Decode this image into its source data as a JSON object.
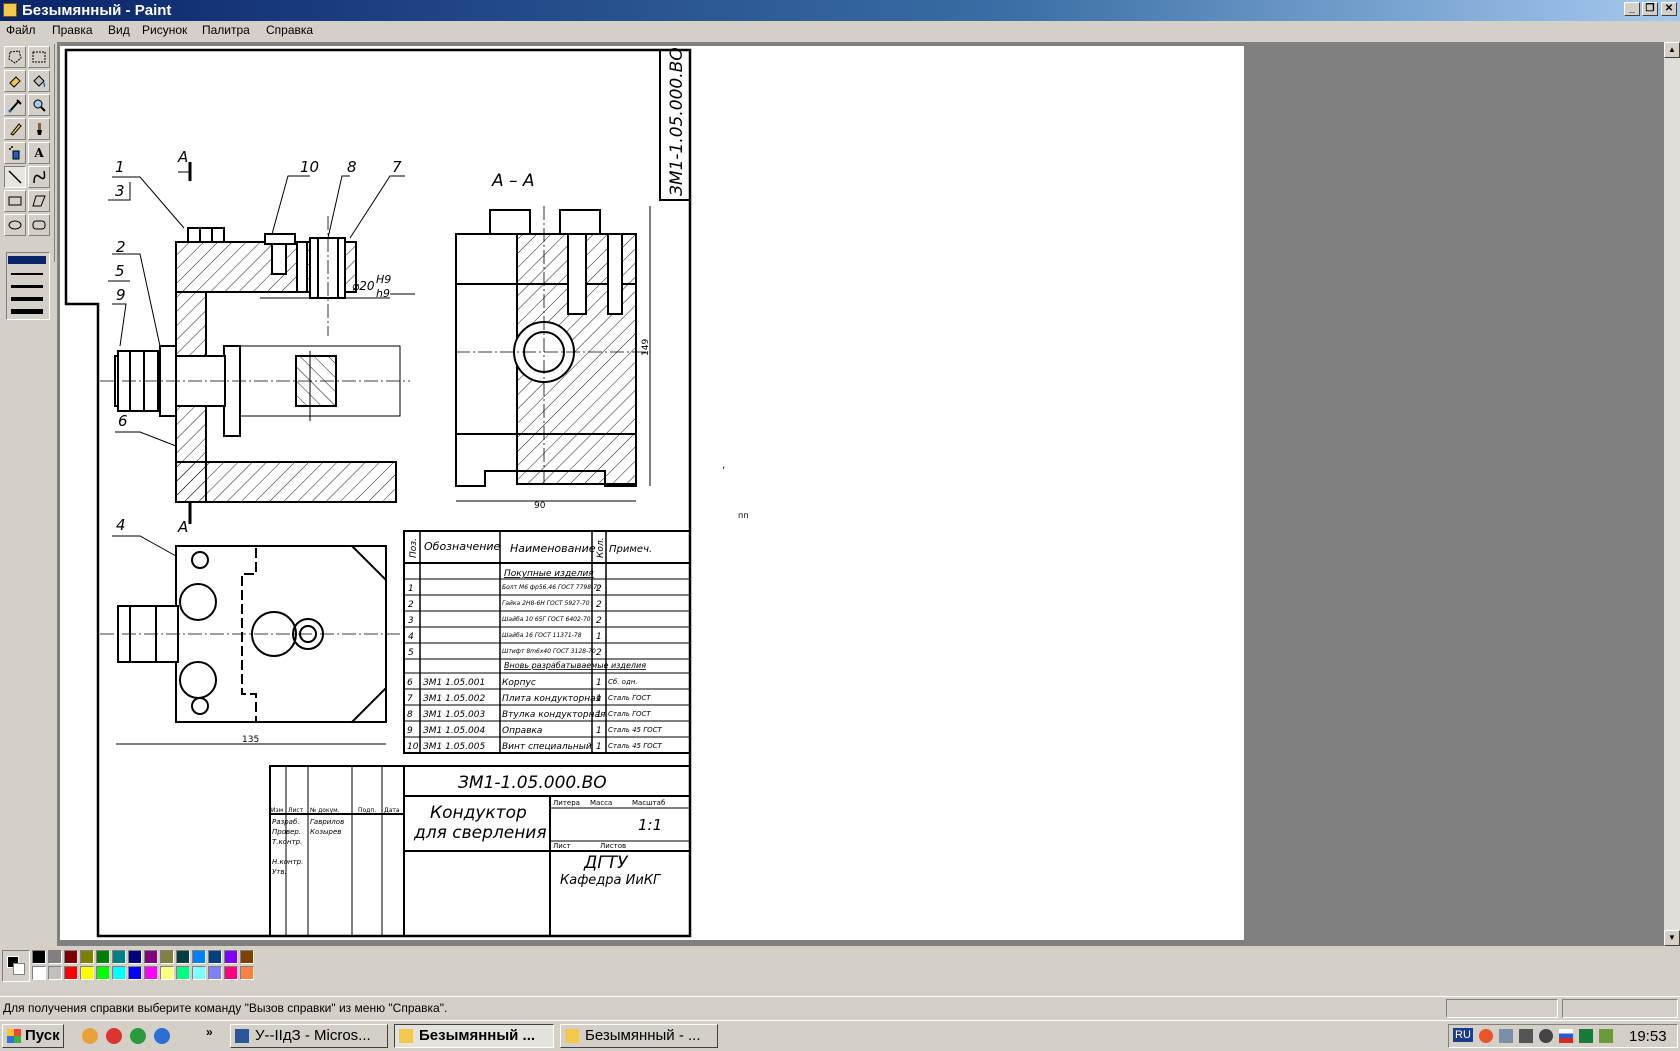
{
  "window": {
    "title": "Безымянный - Paint",
    "minimize": "_",
    "restore": "❐",
    "close": "✕"
  },
  "menu": [
    "Файл",
    "Правка",
    "Вид",
    "Рисунок",
    "Палитра",
    "Справка"
  ],
  "tools": [
    {
      "name": "free-select-icon"
    },
    {
      "name": "rect-select-icon"
    },
    {
      "name": "eraser-icon"
    },
    {
      "name": "fill-icon"
    },
    {
      "name": "pick-color-icon"
    },
    {
      "name": "magnifier-icon"
    },
    {
      "name": "pencil-icon"
    },
    {
      "name": "brush-icon"
    },
    {
      "name": "airbrush-icon"
    },
    {
      "name": "text-icon",
      "glyph": "A"
    },
    {
      "name": "line-icon"
    },
    {
      "name": "curve-icon"
    },
    {
      "name": "rectangle-icon"
    },
    {
      "name": "polygon-icon"
    },
    {
      "name": "ellipse-icon"
    },
    {
      "name": "rounded-rect-icon"
    }
  ],
  "drawing": {
    "stamp_code": "ЗМ1-1.05.000.ВО",
    "section_label": "А – А",
    "section_mark": "А",
    "leaders": [
      "1",
      "3",
      "10",
      "8",
      "7",
      "2",
      "5",
      "9",
      "6",
      "4"
    ],
    "fit_label": "⌀20",
    "fit_upper": "H9",
    "fit_lower": "h9",
    "dim_height": "149",
    "dim_width_side": "90",
    "dim_width_plan": "135",
    "spec_headers": [
      "Поз.",
      "Обозначение",
      "Наименование",
      "Кол.",
      "Примеч."
    ],
    "spec_sections": [
      "Покупные изделия",
      "Вновь разрабатываемые изделия"
    ],
    "purchased": [
      {
        "pos": "1",
        "name": "Болт М6 фр56.46 ГОСТ 7798-70",
        "qty": "2"
      },
      {
        "pos": "2",
        "name": "Гайка 2Н8-6Н ГОСТ 5927-70",
        "qty": "2"
      },
      {
        "pos": "3",
        "name": "Шайба 10 65Г ГОСТ 6402-70",
        "qty": "2"
      },
      {
        "pos": "4",
        "name": "Шайба 16 ГОСТ 11371-78",
        "qty": "1"
      },
      {
        "pos": "5",
        "name": "Штифт 8m6х40 ГОСТ 3128-70",
        "qty": "2"
      }
    ],
    "designed": [
      {
        "pos": "6",
        "code": "ЗМ1 1.05.001",
        "name": "Корпус",
        "qty": "1",
        "note": "Сб. одн."
      },
      {
        "pos": "7",
        "code": "ЗМ1 1.05.002",
        "name": "Плита кондукторная",
        "qty": "1",
        "note": "Сталь ГОСТ"
      },
      {
        "pos": "8",
        "code": "ЗМ1 1.05.003",
        "name": "Втулка кондукторная",
        "qty": "1",
        "note": "Сталь ГОСТ"
      },
      {
        "pos": "9",
        "code": "ЗМ1 1.05.004",
        "name": "Оправка",
        "qty": "1",
        "note": "Сталь 45 ГОСТ"
      },
      {
        "pos": "10",
        "code": "ЗМ1 1.05.005",
        "name": "Винт специальный",
        "qty": "1",
        "note": "Сталь 45 ГОСТ"
      }
    ],
    "title_code": "ЗМ1-1.05.000.ВО",
    "title_name_1": "Кондуктор",
    "title_name_2": "для сверления",
    "col_labels": [
      "Изм",
      "Лист",
      "№ докум.",
      "Подп.",
      "Дата"
    ],
    "role_labels": [
      "Разраб.",
      "Провер.",
      "Т.контр.",
      "Н.контр.",
      "Утв."
    ],
    "people": [
      "Гаврилов",
      "Козырев"
    ],
    "meta_labels": [
      "Литера",
      "Масса",
      "Масштаб",
      "Лист",
      "Листов"
    ],
    "scale": "1:1",
    "org_1": "ДГТУ",
    "org_2": "Кафедра ИиКГ",
    "stray_mark_1": ",",
    "stray_mark_2": "пп"
  },
  "palette": [
    "#000000",
    "#808080",
    "#800000",
    "#808000",
    "#008000",
    "#008080",
    "#000080",
    "#800080",
    "#808040",
    "#004040",
    "#0080ff",
    "#004080",
    "#8000ff",
    "#804000",
    "#ffffff",
    "#c0c0c0",
    "#ff0000",
    "#ffff00",
    "#00ff00",
    "#00ffff",
    "#0000ff",
    "#ff00ff",
    "#ffff80",
    "#00ff80",
    "#80ffff",
    "#8080ff",
    "#ff0080",
    "#ff8040"
  ],
  "status": "Для получения справки выберите команду \"Вызов справки\" из меню \"Справка\".",
  "taskbar": {
    "start": "Пуск",
    "more": "»",
    "buttons": [
      {
        "label": "У--IIдЗ - Micros...",
        "active": false
      },
      {
        "label": "Безымянный ...",
        "active": true
      },
      {
        "label": "Безымянный - ...",
        "active": false
      }
    ],
    "lang": "RU",
    "clock": "19:53"
  }
}
